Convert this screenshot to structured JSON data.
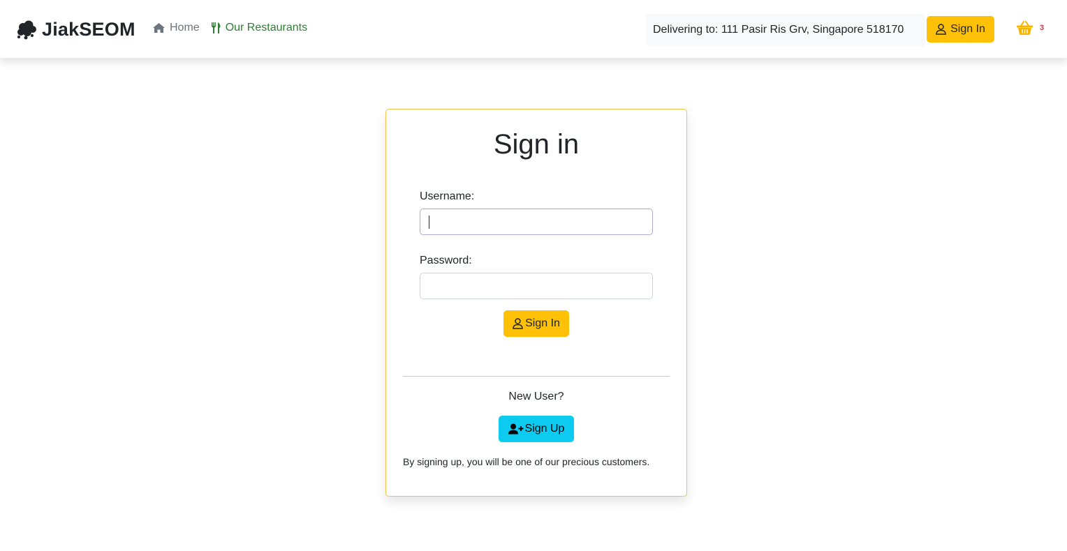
{
  "brand": {
    "name": "JiakSEOM",
    "icon": "cloud-cluster-icon"
  },
  "nav": {
    "home": {
      "label": "Home",
      "icon": "home-icon"
    },
    "restaurants": {
      "label": "Our Restaurants",
      "icon": "utensils-icon"
    }
  },
  "header": {
    "delivery_text": "Delivering to: 111 Pasir Ris Grv, Singapore 518170",
    "signin_label": "Sign In",
    "cart_count": "3"
  },
  "signin_form": {
    "title": "Sign in",
    "username_label": "Username:",
    "username_value": "",
    "password_label": "Password:",
    "password_value": "",
    "submit_label": "Sign In"
  },
  "signup_section": {
    "prompt": "New User?",
    "button_label": "Sign Up",
    "note": "By signing up, you will be one of our precious customers."
  },
  "colors": {
    "primary_yellow": "#ffc107",
    "info_cyan": "#0dcaf0",
    "card_border": "#f0c24a",
    "restaurants_green": "#2e7d32",
    "cart_badge_red": "#dc3545"
  }
}
